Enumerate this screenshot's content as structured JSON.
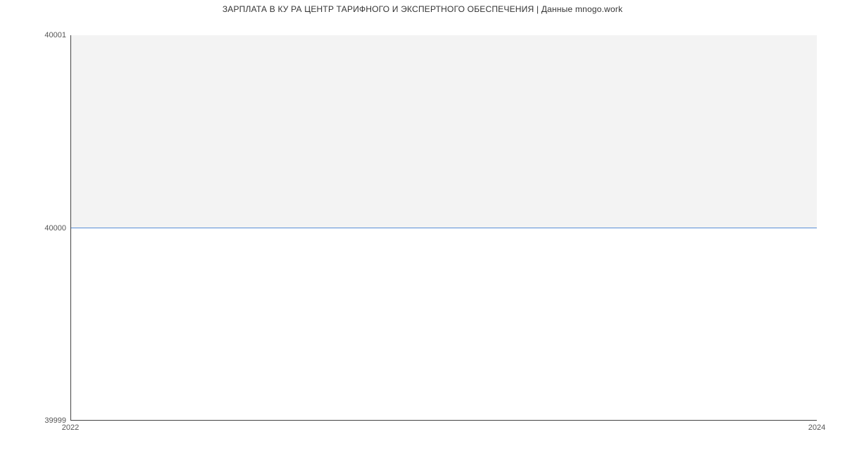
{
  "chart_data": {
    "type": "line",
    "title": "ЗАРПЛАТА В КУ РА ЦЕНТР ТАРИФНОГО И ЭКСПЕРТНОГО ОБЕСПЕЧЕНИЯ | Данные mnogo.work",
    "xlabel": "",
    "ylabel": "",
    "xlim": [
      2022,
      2024
    ],
    "ylim": [
      39999,
      40001
    ],
    "x": [
      2022,
      2024
    ],
    "values": [
      40000,
      40000
    ],
    "x_ticks": [
      "2022",
      "2024"
    ],
    "y_ticks": [
      "39999",
      "40000",
      "40001"
    ],
    "grid": true,
    "series_color": "#5a8fd6",
    "plot_bg": "#f3f3f3"
  }
}
